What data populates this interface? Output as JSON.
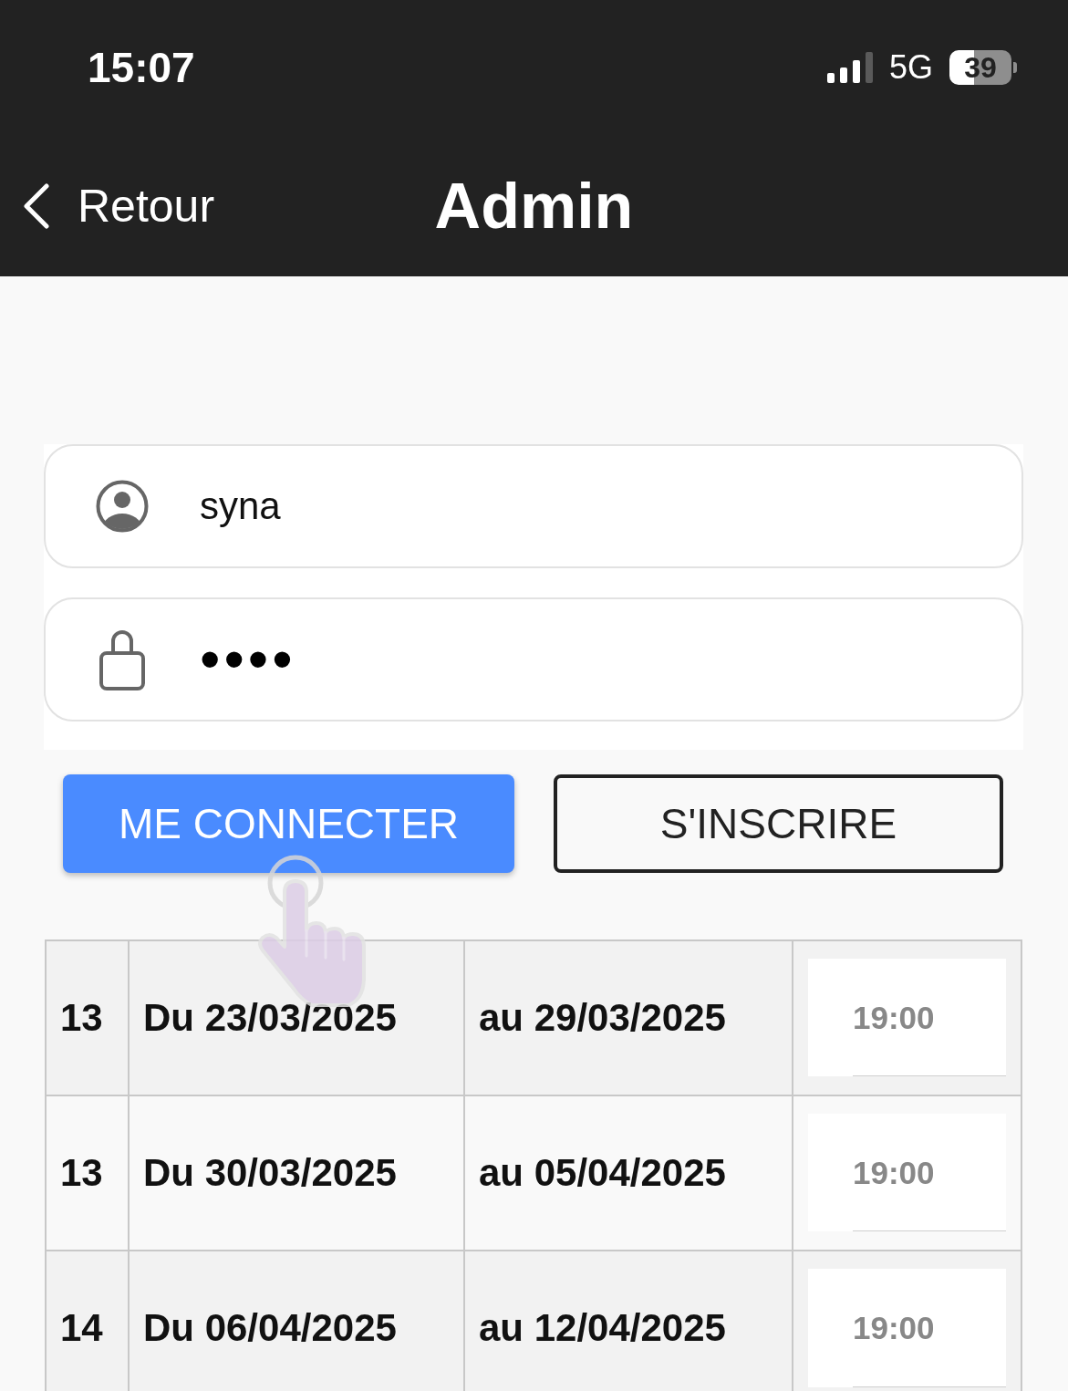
{
  "status_bar": {
    "time": "15:07",
    "network": "5G",
    "battery": "39"
  },
  "nav": {
    "back_label": "Retour",
    "title": "Admin"
  },
  "login_form": {
    "username": {
      "value": "syna"
    },
    "password": {
      "value": "••••"
    }
  },
  "buttons": [
    {
      "label": "ME CONNECTER",
      "kind": "primary"
    },
    {
      "label": "S'INSCRIRE",
      "kind": "outline"
    }
  ],
  "table": {
    "rows": [
      {
        "cells": [
          "13",
          "Du 23/03/2025",
          "au 29/03/2025"
        ],
        "time": "19:00"
      },
      {
        "cells": [
          "13",
          "Du 30/03/2025",
          "au 05/04/2025"
        ],
        "time": "19:00"
      },
      {
        "cells": [
          "14",
          "Du 06/04/2025",
          "au 12/04/2025"
        ],
        "time": "19:00"
      }
    ]
  }
}
